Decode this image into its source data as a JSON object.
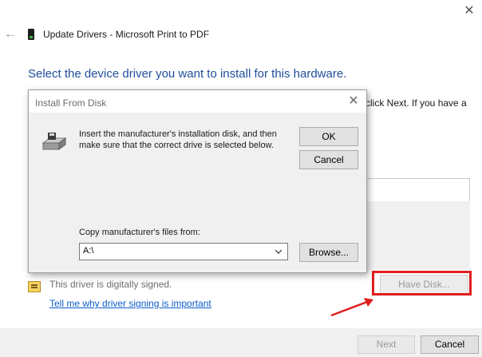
{
  "window": {
    "title": "Update Drivers - Microsoft Print to PDF",
    "close_icon": "close-icon",
    "back_icon": "back-arrow-icon",
    "heading": "Select the device driver you want to install for this hardware.",
    "partial_instruction": "click Next. If you have a",
    "signed_text": "This driver is digitally signed.",
    "signing_link": "Tell me why driver signing is important",
    "have_disk_label": "Have Disk...",
    "next_label": "Next",
    "cancel_label": "Cancel"
  },
  "dialog": {
    "title": "Install From Disk",
    "message": "Insert the manufacturer's installation disk, and then make sure that the correct drive is selected below.",
    "ok_label": "OK",
    "cancel_label": "Cancel",
    "copy_label": "Copy manufacturer's files from:",
    "copy_value": "A:\\",
    "browse_label": "Browse..."
  },
  "colors": {
    "heading": "#1f4e9c",
    "link": "#0b5dcc",
    "highlight": "#e01e1e"
  }
}
